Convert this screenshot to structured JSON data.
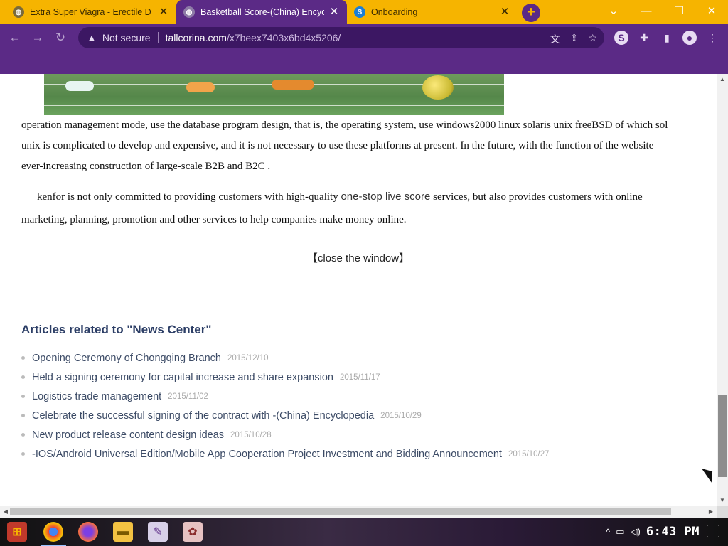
{
  "browser": {
    "tabs": [
      {
        "title": "Extra Super Viagra - Erectile D",
        "favicon": "globe-icon",
        "active": false
      },
      {
        "title": "Basketball Score-(China) Encyc",
        "favicon": "globe-icon",
        "active": true
      },
      {
        "title": "Onboarding",
        "favicon": "s-logo-icon",
        "active": false
      }
    ],
    "new_tab_label": "+",
    "security_label": "Not secure",
    "url_host": "tallcorina.com",
    "url_path": "/x7beex7403x6bd4x5206/",
    "accent_color": "#5b2a86",
    "tabstrip_color": "#f6b400"
  },
  "article": {
    "para1_line1": "operation management mode, use the database program design, that is, the operating system, use windows2000 linux solaris unix freeBSD of which sol",
    "para1_line2": "unix is complicated to develop and expensive, and it is not necessary to use these platforms at present. In the future, with the function of the website",
    "para1_line3": "ever-increasing construction of large-scale B2B and B2C .",
    "para2_prefix": "kenfor is not only committed to providing customers with high-quality ",
    "para2_link": "one-stop live score",
    "para2_suffix": " services, but also provides customers with online",
    "para2_line2": "marketing, planning, promotion and other services to help companies make money online.",
    "close_window": "【close the window】"
  },
  "related": {
    "title": "Articles related to \"News Center\"",
    "items": [
      {
        "label": "Opening Ceremony of Chongqing Branch",
        "date": "2015/12/10"
      },
      {
        "label": "Held a signing ceremony for capital increase and share expansion",
        "date": "2015/11/17"
      },
      {
        "label": "Logistics trade management",
        "date": "2015/11/02"
      },
      {
        "label": "Celebrate the successful signing of the contract with -(China) Encyclopedia",
        "date": "2015/10/29"
      },
      {
        "label": "New product release content design ideas",
        "date": "2015/10/28"
      },
      {
        "label": "-IOS/Android Universal Edition/Mobile App Cooperation Project Investment and Bidding Announcement",
        "date": "2015/10/27"
      }
    ]
  },
  "taskbar": {
    "clock": "6:43 PM",
    "apps": [
      "start-icon",
      "chrome-icon",
      "firefox-icon",
      "file-explorer-icon",
      "paint-icon",
      "app-icon"
    ]
  }
}
